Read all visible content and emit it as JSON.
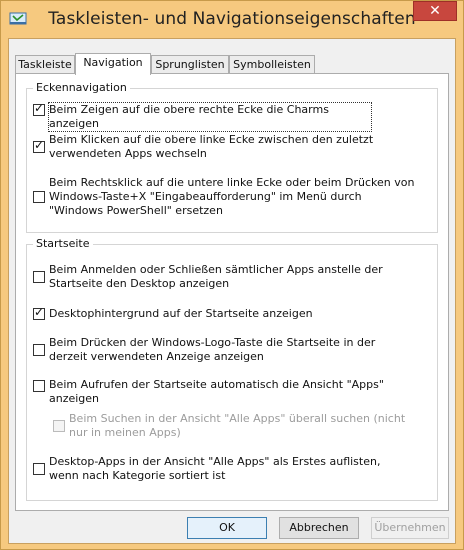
{
  "window": {
    "title": "Taskleisten- und Navigationseigenschaften",
    "close_glyph": "✕",
    "icon": "taskbar-properties-icon"
  },
  "tabs": [
    {
      "label": "Taskleiste"
    },
    {
      "label": "Navigation",
      "active": true
    },
    {
      "label": "Sprunglisten"
    },
    {
      "label": "Symbolleisten"
    }
  ],
  "corner_nav": {
    "heading": "Eckennavigation",
    "options": [
      {
        "label": "Beim Zeigen auf die obere rechte Ecke die Charms anzeigen",
        "checked": true
      },
      {
        "label": "Beim Klicken auf die obere linke Ecke zwischen den zuletzt\nverwendeten Apps wechseln",
        "checked": true
      },
      {
        "label": "Beim Rechtsklick auf die untere linke Ecke oder beim Drücken von\nWindows-Taste+X \"Eingabeaufforderung\" im Menü durch\n\"Windows PowerShell\" ersetzen",
        "checked": false
      }
    ]
  },
  "start": {
    "heading": "Startseite",
    "options": [
      {
        "label": "Beim Anmelden oder Schließen sämtlicher Apps anstelle der\nStartseite den Desktop anzeigen",
        "checked": false
      },
      {
        "label": "Desktophintergrund auf der Startseite anzeigen",
        "checked": true
      },
      {
        "label": "Beim Drücken der Windows-Logo-Taste die Startseite in der\nderzeit verwendeten Anzeige anzeigen",
        "checked": false
      },
      {
        "label": "Beim Aufrufen der Startseite automatisch die Ansicht \"Apps\"\nanzeigen",
        "checked": false
      },
      {
        "label": "Beim Suchen in der Ansicht \"Alle Apps\" überall suchen (nicht\nnur in meinen Apps)",
        "checked": false,
        "disabled": true
      },
      {
        "label": "Desktop-Apps in der Ansicht \"Alle Apps\" als Erstes auflisten,\nwenn nach Kategorie sortiert ist",
        "checked": false
      }
    ]
  },
  "buttons": {
    "ok": "OK",
    "cancel": "Abbrechen",
    "apply": "Übernehmen"
  },
  "colors": {
    "frame": "#f6c97f",
    "close": "#c8473e",
    "accent": "#3c7fb1"
  }
}
